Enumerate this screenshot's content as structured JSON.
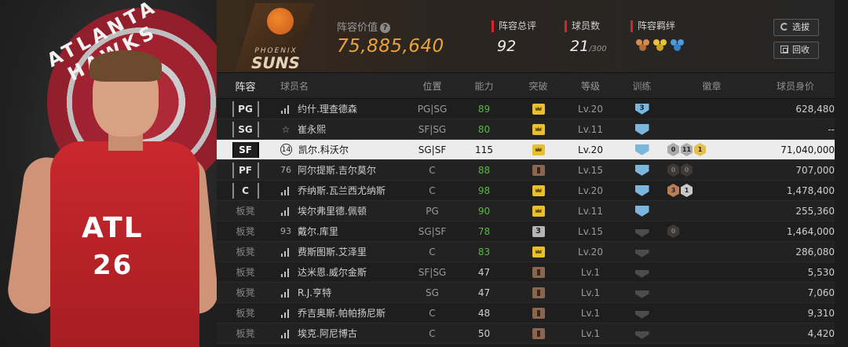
{
  "player_art": {
    "logo_text": "ATLANTA HAWKS",
    "jersey_team": "ATL",
    "jersey_number": "26"
  },
  "header": {
    "team_logo": {
      "line1": "PHOENIX",
      "line2": "SUNS"
    },
    "lineup_value_label": "阵容价值",
    "lineup_value": "75,885,640",
    "overall_label": "阵容总评",
    "overall": "92",
    "players_label": "球员数",
    "players_count": "21",
    "players_max": "/300",
    "chemistry_label": "阵容羁绊",
    "chemistry_icons": [
      "chemistry-bronze-icon",
      "chemistry-gold-icon",
      "chemistry-blue-icon"
    ],
    "buttons": {
      "select": "选拔",
      "recycle": "回收"
    }
  },
  "table": {
    "headers": {
      "lineup": "阵容",
      "name": "球员名",
      "position": "位置",
      "ability": "能力",
      "breakthrough": "突破",
      "level": "等级",
      "training": "训练",
      "badges": "徽章",
      "value": "球员身价"
    },
    "rows": [
      {
        "slot": "PG",
        "num": "",
        "num_type": "signal",
        "name": "约什.理查德森",
        "pos": "PG|SG",
        "ability": "89",
        "ability_green": true,
        "break": "gold",
        "level": "Lv.20",
        "train": "3",
        "train_type": "blue",
        "badges": [],
        "price": "628,480"
      },
      {
        "slot": "SG",
        "num": "☆",
        "num_type": "star",
        "name": "崔永熙",
        "pos": "SF|SG",
        "ability": "80",
        "ability_green": true,
        "break": "gold",
        "level": "Lv.11",
        "train": "",
        "train_type": "blue",
        "badges": [],
        "price": "--"
      },
      {
        "slot": "SF",
        "num": "14",
        "num_type": "circle",
        "name": "凯尔.科沃尔",
        "pos": "SG|SF",
        "ability": "115",
        "ability_green": false,
        "break": "gold",
        "level": "Lv.20",
        "train": "",
        "train_type": "blue",
        "badges": [
          {
            "t": "s",
            "v": "0"
          },
          {
            "t": "s",
            "v": "11"
          },
          {
            "t": "g",
            "v": "1"
          }
        ],
        "price": "71,040,000"
      },
      {
        "slot": "PF",
        "num": "76",
        "num_type": "number",
        "name": "阿尔提斯.吉尔莫尔",
        "pos": "C",
        "ability": "88",
        "ability_green": true,
        "break": "bronze",
        "level": "Lv.15",
        "train": "",
        "train_type": "blue",
        "badges": [
          {
            "t": "d",
            "v": "0"
          },
          {
            "t": "d",
            "v": "0"
          }
        ],
        "price": "707,000"
      },
      {
        "slot": "C",
        "num": "",
        "num_type": "signal",
        "name": "乔纳斯.瓦兰西尤纳斯",
        "pos": "C",
        "ability": "98",
        "ability_green": true,
        "break": "gold",
        "level": "Lv.20",
        "train": "",
        "train_type": "blue",
        "badges": [
          {
            "t": "b",
            "v": "3"
          },
          {
            "t": "s",
            "v": "1"
          }
        ],
        "price": "1,478,400"
      },
      {
        "slot": "板凳",
        "num": "",
        "num_type": "signal",
        "name": "埃尔弗里德.佩顿",
        "pos": "PG",
        "ability": "90",
        "ability_green": true,
        "break": "gold",
        "level": "Lv.11",
        "train": "",
        "train_type": "blue",
        "badges": [],
        "price": "255,360"
      },
      {
        "slot": "板凳",
        "num": "93",
        "num_type": "number",
        "name": "戴尔.库里",
        "pos": "SG|SF",
        "ability": "78",
        "ability_green": true,
        "break": "silver",
        "break_val": "3",
        "level": "Lv.15",
        "train": "",
        "train_type": "grey",
        "badges": [
          {
            "t": "d",
            "v": "0"
          }
        ],
        "price": "1,464,000"
      },
      {
        "slot": "板凳",
        "num": "",
        "num_type": "signal",
        "name": "费斯图斯.艾泽里",
        "pos": "C",
        "ability": "83",
        "ability_green": true,
        "break": "gold",
        "level": "Lv.20",
        "train": "",
        "train_type": "grey",
        "badges": [],
        "price": "286,080"
      },
      {
        "slot": "板凳",
        "num": "",
        "num_type": "signal",
        "name": "达米恩.威尔金斯",
        "pos": "SF|SG",
        "ability": "47",
        "ability_green": false,
        "break": "bronze",
        "level": "Lv.1",
        "train": "",
        "train_type": "grey",
        "badges": [],
        "price": "5,530"
      },
      {
        "slot": "板凳",
        "num": "",
        "num_type": "signal",
        "name": "R.J.亨特",
        "pos": "SG",
        "ability": "47",
        "ability_green": false,
        "break": "bronze",
        "level": "Lv.1",
        "train": "",
        "train_type": "grey",
        "badges": [],
        "price": "7,060"
      },
      {
        "slot": "板凳",
        "num": "",
        "num_type": "signal",
        "name": "乔吉奥斯.帕帕扬尼斯",
        "pos": "C",
        "ability": "48",
        "ability_green": false,
        "break": "bronze",
        "level": "Lv.1",
        "train": "",
        "train_type": "grey",
        "badges": [],
        "price": "9,310"
      },
      {
        "slot": "板凳",
        "num": "",
        "num_type": "signal",
        "name": "埃克.阿尼博古",
        "pos": "C",
        "ability": "50",
        "ability_green": false,
        "break": "bronze",
        "level": "Lv.1",
        "train": "",
        "train_type": "grey",
        "badges": [],
        "price": "4,420"
      }
    ],
    "selected_index": 2
  }
}
